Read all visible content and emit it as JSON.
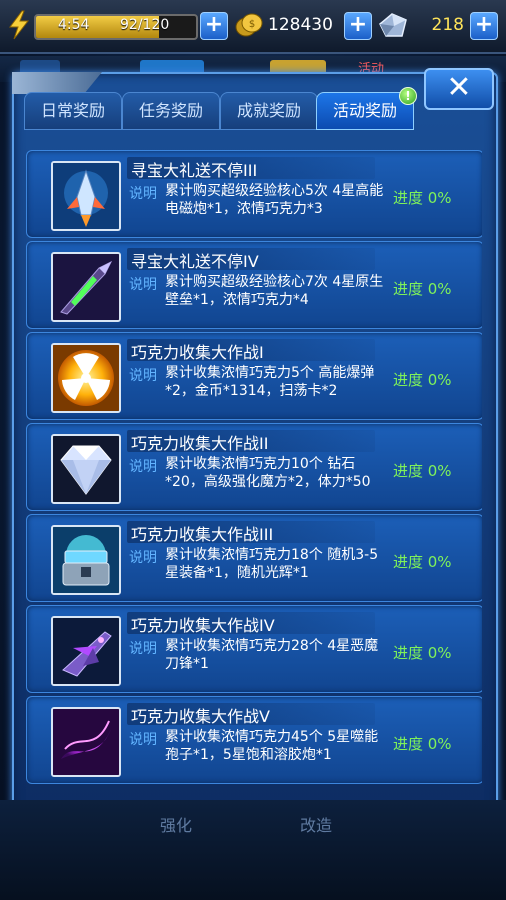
{
  "status": {
    "energy_time": "4:54",
    "energy_value": "92/120",
    "energy_fraction": 0.77,
    "coins": "128430",
    "gems": "218",
    "plus_label": "+"
  },
  "background": {
    "tab_hint": "活动",
    "nav_left": "强化",
    "nav_right": "改造"
  },
  "panel": {
    "close_label": "✕",
    "tabs": [
      {
        "label": "日常奖励",
        "active": false
      },
      {
        "label": "任务奖励",
        "active": false
      },
      {
        "label": "成就奖励",
        "active": false
      },
      {
        "label": "活动奖励",
        "active": true,
        "badge": "!"
      }
    ],
    "desc_label": "说明",
    "progress_label": "进度 0%",
    "items": [
      {
        "title": "寻宝大礼送不停III",
        "desc": "累计购买超级经验核心5次 4星高能电磁炮*1，浓情巧克力*3",
        "icon": "rocket-icon"
      },
      {
        "title": "寻宝大礼送不停IV",
        "desc": "累计购买超级经验核心7次 4星原生壁垒*1，浓情巧克力*4",
        "icon": "green-fighter-icon"
      },
      {
        "title": "巧克力收集大作战I",
        "desc": "累计收集浓情巧克力5个 高能爆弹*2，金币*1314，扫荡卡*2",
        "icon": "radiation-bomb-icon"
      },
      {
        "title": "巧克力收集大作战II",
        "desc": "累计收集浓情巧克力10个 钻石*20，高级强化魔方*2，体力*50",
        "icon": "diamond-icon"
      },
      {
        "title": "巧克力收集大作战III",
        "desc": "累计收集浓情巧克力18个 随机3-5星装备*1，随机光辉*1",
        "icon": "glowing-chest-icon"
      },
      {
        "title": "巧克力收集大作战IV",
        "desc": "累计收集浓情巧克力28个 4星恶魔刀锋*1",
        "icon": "purple-fighter-icon"
      },
      {
        "title": "巧克力收集大作战V",
        "desc": "累计收集浓情巧克力45个 5星噬能孢子*1，5星饱和溶胶炮*1",
        "icon": "spore-icon"
      }
    ]
  }
}
